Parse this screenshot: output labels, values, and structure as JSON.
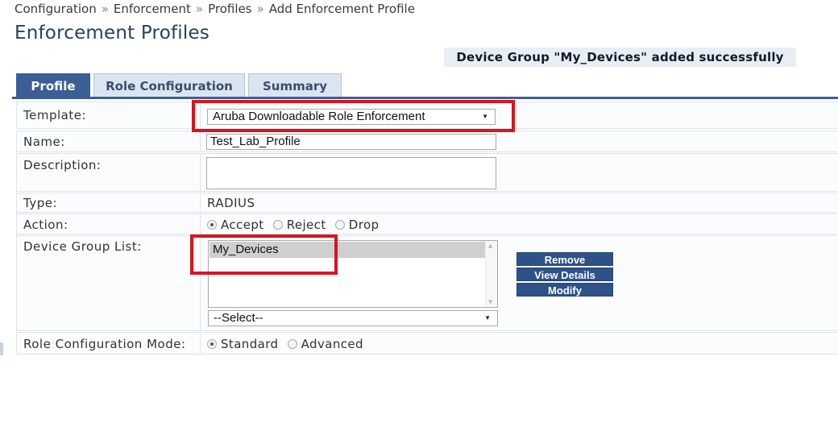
{
  "breadcrumb": {
    "items": [
      "Configuration",
      "Enforcement",
      "Profiles",
      "Add Enforcement Profile"
    ],
    "separator": "»"
  },
  "page": {
    "title": "Enforcement Profiles",
    "notice": "Device Group \"My_Devices\" added successfully"
  },
  "tabs": [
    {
      "label": "Profile",
      "active": true
    },
    {
      "label": "Role Configuration",
      "active": false
    },
    {
      "label": "Summary",
      "active": false
    }
  ],
  "form": {
    "template": {
      "label": "Template:",
      "value": "Aruba Downloadable Role Enforcement"
    },
    "name": {
      "label": "Name:",
      "value": "Test_Lab_Profile"
    },
    "description": {
      "label": "Description:",
      "value": ""
    },
    "type": {
      "label": "Type:",
      "value": "RADIUS"
    },
    "action": {
      "label": "Action:",
      "options": [
        "Accept",
        "Reject",
        "Drop"
      ],
      "selected": "Accept"
    },
    "device_group_list": {
      "label": "Device Group List:",
      "items": [
        "My_Devices"
      ],
      "select_placeholder": "--Select--",
      "buttons": {
        "remove": "Remove",
        "view_details": "View Details",
        "modify": "Modify"
      }
    },
    "role_config_mode": {
      "label": "Role Configuration Mode:",
      "options": [
        "Standard",
        "Advanced"
      ],
      "selected": "Standard"
    }
  },
  "colors": {
    "accent": "#3b5f95",
    "button": "#2e5288",
    "highlight": "#d8141f",
    "notice_bg": "#e8eef4",
    "title": "#2a3f5e"
  }
}
